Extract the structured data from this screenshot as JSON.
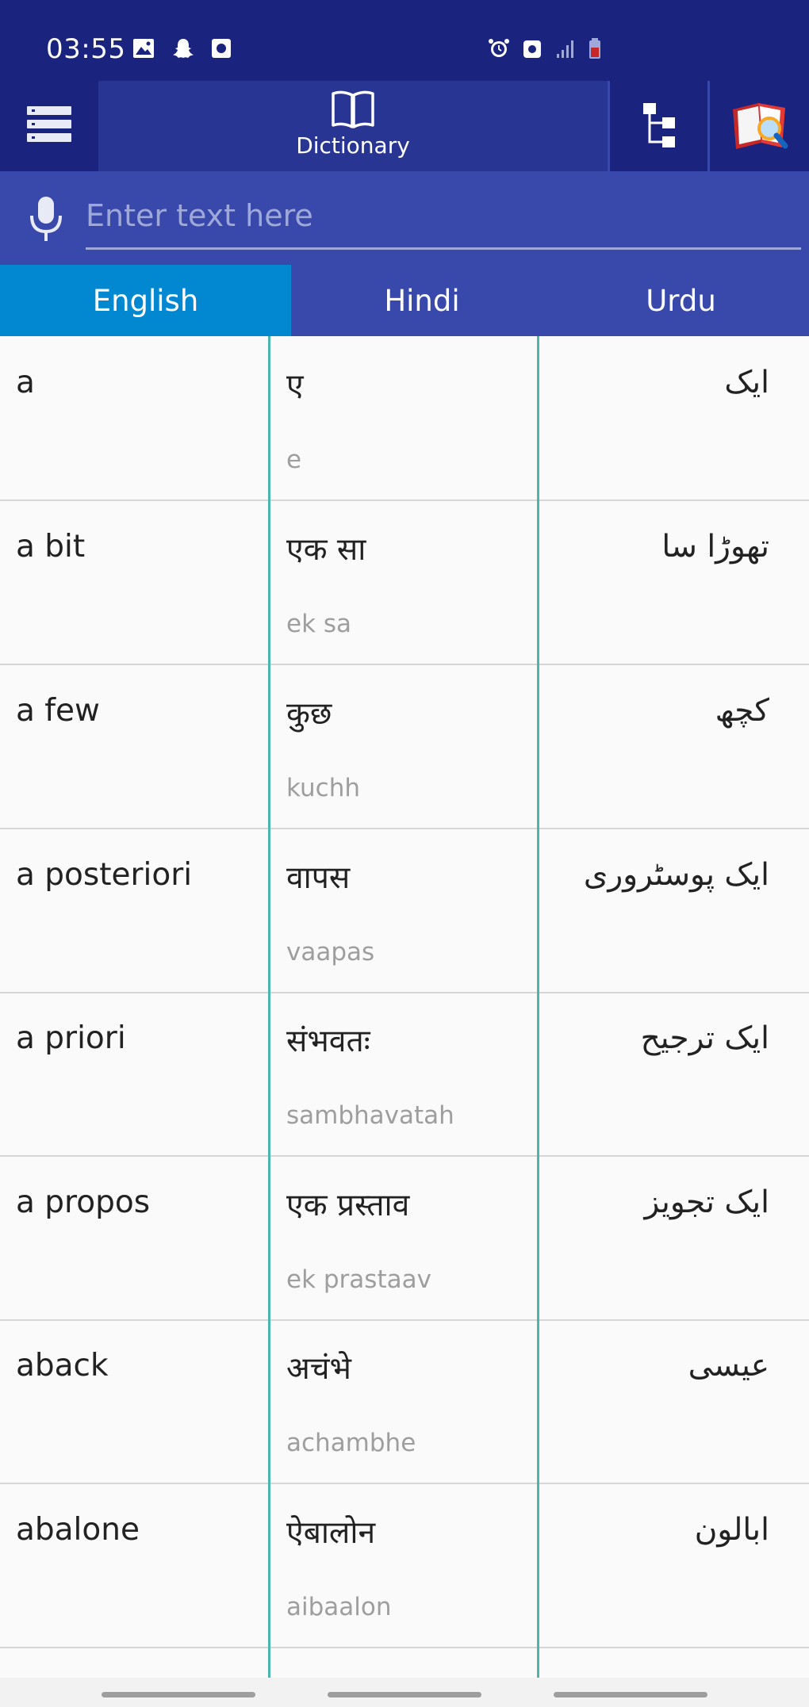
{
  "status_bar": {
    "time": "03:55",
    "left_icons": [
      "image-icon",
      "snapchat-icon",
      "app-icon"
    ],
    "right_icons": [
      "alarm-icon",
      "sync-icon",
      "signal-icon",
      "battery-icon"
    ]
  },
  "toolbar": {
    "dictionary_label": "Dictionary",
    "icons": [
      "menu-icon",
      "book-icon",
      "tree-icon",
      "dictionary-lookup-icon"
    ]
  },
  "search": {
    "placeholder": "Enter text here",
    "value": ""
  },
  "languages": [
    "English",
    "Hindi",
    "Urdu"
  ],
  "active_language": "English",
  "rows": [
    {
      "english": "a",
      "hindi": "ए",
      "translit": "e",
      "urdu": "ایک"
    },
    {
      "english": "a bit",
      "hindi": "एक सा",
      "translit": "ek sa",
      "urdu": "تھوڑا سا"
    },
    {
      "english": "a few",
      "hindi": "कुछ",
      "translit": "kuchh",
      "urdu": "کچھ"
    },
    {
      "english": "a posteriori",
      "hindi": "वापस",
      "translit": "vaapas",
      "urdu": "ایک پوسٹروری"
    },
    {
      "english": "a priori",
      "hindi": "संभवतः",
      "translit": "sambhavatah",
      "urdu": "ایک ترجیح"
    },
    {
      "english": "a propos",
      "hindi": "एक प्रस्ताव",
      "translit": "ek prastaav",
      "urdu": "ایک تجویز"
    },
    {
      "english": "aback",
      "hindi": "अचंभे",
      "translit": "achambhe",
      "urdu": "عیسی"
    },
    {
      "english": "abalone",
      "hindi": "ऐबालोन",
      "translit": "aibaalon",
      "urdu": "ابالون"
    }
  ],
  "colors": {
    "status_bar": "#1a237e",
    "toolbar": "#1a237e",
    "toolbar_active": "#283593",
    "search_bar": "#3949ab",
    "active_tab": "#0288d1",
    "divider": "#4db6ac"
  }
}
